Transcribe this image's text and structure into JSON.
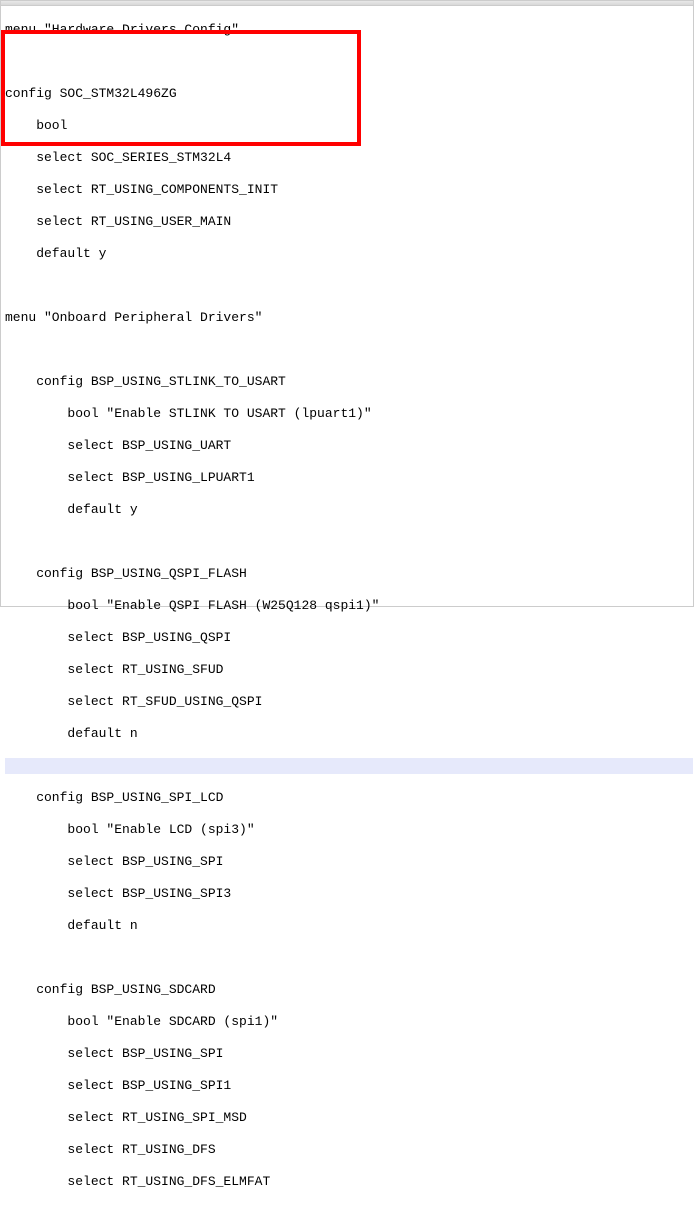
{
  "lines": {
    "l1": "menu \"Hardware Drivers Config\"",
    "l2": "",
    "l3": "config SOC_STM32L496ZG",
    "l4": "    bool",
    "l5": "    select SOC_SERIES_STM32L4",
    "l6": "    select RT_USING_COMPONENTS_INIT",
    "l7": "    select RT_USING_USER_MAIN",
    "l8": "    default y",
    "l9": "",
    "l10": "menu \"Onboard Peripheral Drivers\"",
    "l11": "",
    "l12": "    config BSP_USING_STLINK_TO_USART",
    "l13": "        bool \"Enable STLINK TO USART (lpuart1)\"",
    "l14": "        select BSP_USING_UART",
    "l15": "        select BSP_USING_LPUART1",
    "l16": "        default y",
    "l17": "",
    "l18": "    config BSP_USING_QSPI_FLASH",
    "l19": "        bool \"Enable QSPI FLASH (W25Q128 qspi1)\"",
    "l20": "        select BSP_USING_QSPI",
    "l21": "        select RT_USING_SFUD",
    "l22": "        select RT_SFUD_USING_QSPI",
    "l23": "        default n",
    "l24": "",
    "l25": "    config BSP_USING_SPI_LCD",
    "l26": "        bool \"Enable LCD (spi3)\"",
    "l27": "        select BSP_USING_SPI",
    "l28": "        select BSP_USING_SPI3",
    "l29": "        default n",
    "l30": "",
    "l31": "    config BSP_USING_SDCARD",
    "l32": "        bool \"Enable SDCARD (spi1)\"",
    "l33": "        select BSP_USING_SPI",
    "l34": "        select BSP_USING_SPI1",
    "l35": "        select RT_USING_SPI_MSD",
    "l36": "        select RT_USING_DFS",
    "l37": "        select RT_USING_DFS_ELMFAT"
  }
}
